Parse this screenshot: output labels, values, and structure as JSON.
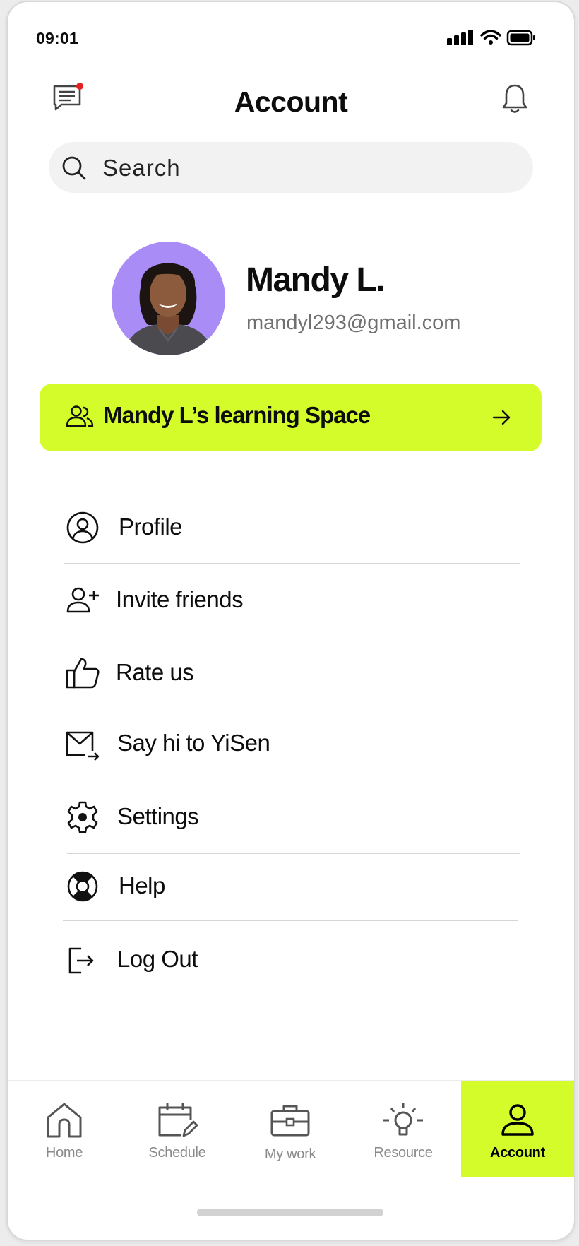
{
  "status_bar": {
    "time": "09:01"
  },
  "header": {
    "title": "Account"
  },
  "search": {
    "placeholder": "Search"
  },
  "profile": {
    "name": "Mandy L.",
    "email": "mandyl293@gmail.com"
  },
  "learning_space": {
    "label": "Mandy L’s learning Space"
  },
  "menu": [
    {
      "label": "Profile",
      "icon": "user-circle-icon"
    },
    {
      "label": "Invite friends",
      "icon": "user-plus-icon"
    },
    {
      "label": "Rate us",
      "icon": "thumbs-up-icon"
    },
    {
      "label": "Say hi to YiSen",
      "icon": "mail-send-icon"
    },
    {
      "label": "Settings",
      "icon": "gear-icon"
    },
    {
      "label": "Help",
      "icon": "lifebuoy-icon"
    },
    {
      "label": "Log Out",
      "icon": "logout-icon"
    }
  ],
  "nav": [
    {
      "label": "Home",
      "icon": "home-icon"
    },
    {
      "label": "Schedule",
      "icon": "calendar-edit-icon"
    },
    {
      "label": "My work",
      "icon": "briefcase-icon"
    },
    {
      "label": "Resource",
      "icon": "lightbulb-icon"
    },
    {
      "label": "Account",
      "icon": "account-icon",
      "active": true
    }
  ],
  "colors": {
    "accent": "#d4fc2a",
    "notification_dot": "#e52222",
    "avatar_background": "#a98cf5",
    "muted_text": "#8a8a8a"
  }
}
